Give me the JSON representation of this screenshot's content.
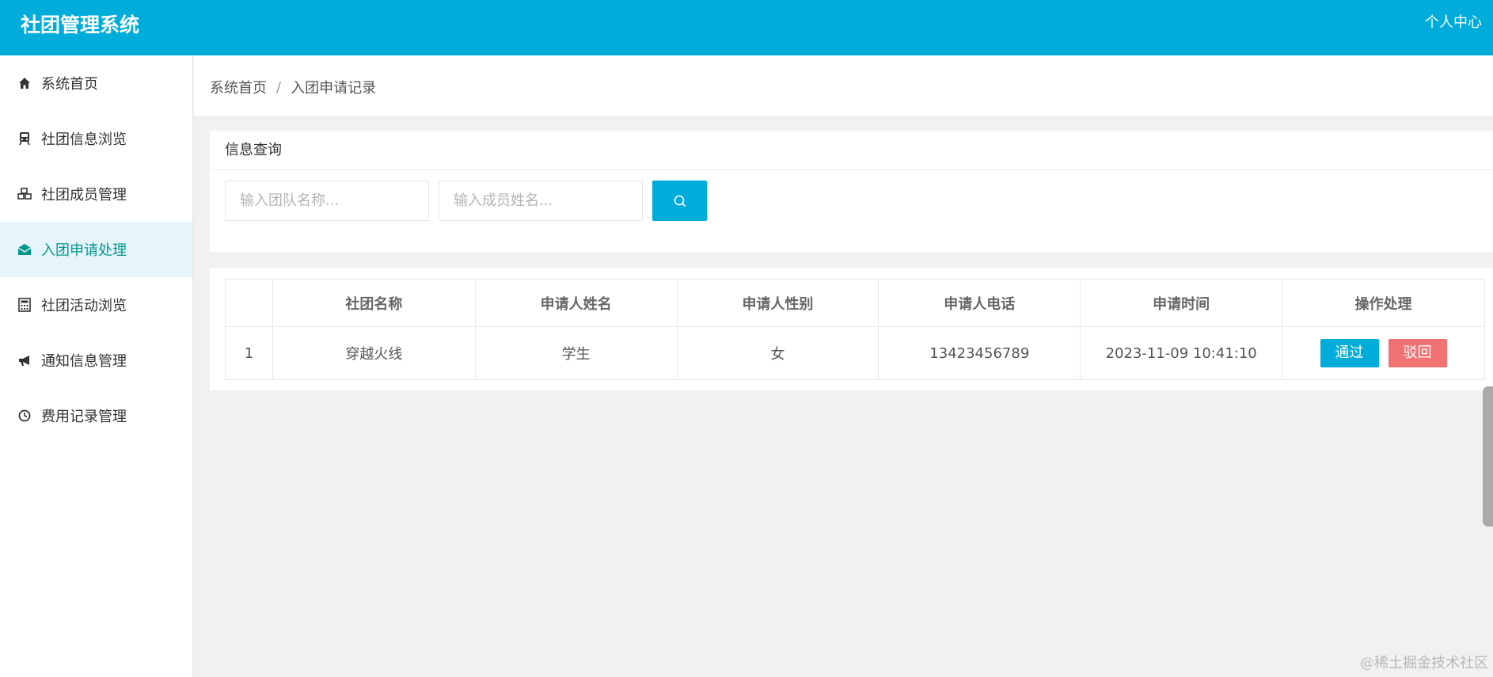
{
  "header": {
    "title": "社团管理系统",
    "user_center": "个人中心"
  },
  "sidebar": {
    "items": [
      {
        "label": "系统首页",
        "icon": "home-icon"
      },
      {
        "label": "社团信息浏览",
        "icon": "train-icon"
      },
      {
        "label": "社团成员管理",
        "icon": "cubes-icon"
      },
      {
        "label": "入团申请处理",
        "icon": "envelope-open-icon",
        "active": true
      },
      {
        "label": "社团活动浏览",
        "icon": "calculator-icon"
      },
      {
        "label": "通知信息管理",
        "icon": "bullhorn-icon"
      },
      {
        "label": "费用记录管理",
        "icon": "clock-icon"
      }
    ]
  },
  "breadcrumb": {
    "home": "系统首页",
    "separator": "/",
    "current": "入团申请记录"
  },
  "query": {
    "title": "信息查询",
    "team_name_placeholder": "输入团队名称...",
    "member_name_placeholder": "输入成员姓名...",
    "search_icon": "search-icon"
  },
  "table": {
    "columns": [
      "",
      "社团名称",
      "申请人姓名",
      "申请人性别",
      "申请人电话",
      "申请时间",
      "操作处理"
    ],
    "rows": [
      {
        "index": "1",
        "club": "穿越火线",
        "name": "学生",
        "gender": "女",
        "phone": "13423456789",
        "time": "2023-11-09 10:41:10"
      }
    ],
    "actions": {
      "pass": "通过",
      "reject": "驳回"
    }
  },
  "watermark": "@稀土掘金技术社区",
  "colors": {
    "primary": "#00acd9",
    "danger": "#f07272",
    "active_text": "#009688",
    "active_bg": "#e6f5fc"
  }
}
